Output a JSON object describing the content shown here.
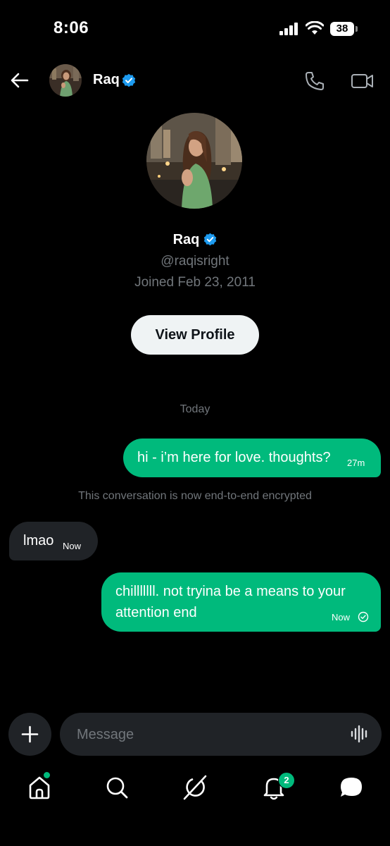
{
  "status_bar": {
    "time": "8:06",
    "battery": "38"
  },
  "header": {
    "name": "Raq",
    "verified": true
  },
  "profile": {
    "name": "Raq",
    "handle": "@raqisright",
    "joined": "Joined Feb 23, 2011",
    "view_profile_label": "View Profile"
  },
  "conversation": {
    "date_divider": "Today",
    "encryption_notice": "This conversation is now end-to-end encrypted",
    "messages": [
      {
        "direction": "outgoing",
        "text": "hi - i’m here for love. thoughts?",
        "time": "27m"
      },
      {
        "direction": "incoming",
        "text": "lmao",
        "time": "Now"
      },
      {
        "direction": "outgoing",
        "lines": [
          "chilllllll. not tryina be a means to your",
          "attention end"
        ],
        "time": "Now",
        "status": "read-check-icon"
      }
    ]
  },
  "composer": {
    "placeholder": "Message"
  },
  "tab_bar": {
    "items": [
      "home-icon",
      "search-icon",
      "grok-icon",
      "notifications-icon",
      "messages-icon"
    ],
    "notifications_count": "2"
  },
  "colors": {
    "accent": "#00ba7c",
    "verified": "#1d9bf0",
    "background": "#000000",
    "muted": "#71767b"
  }
}
